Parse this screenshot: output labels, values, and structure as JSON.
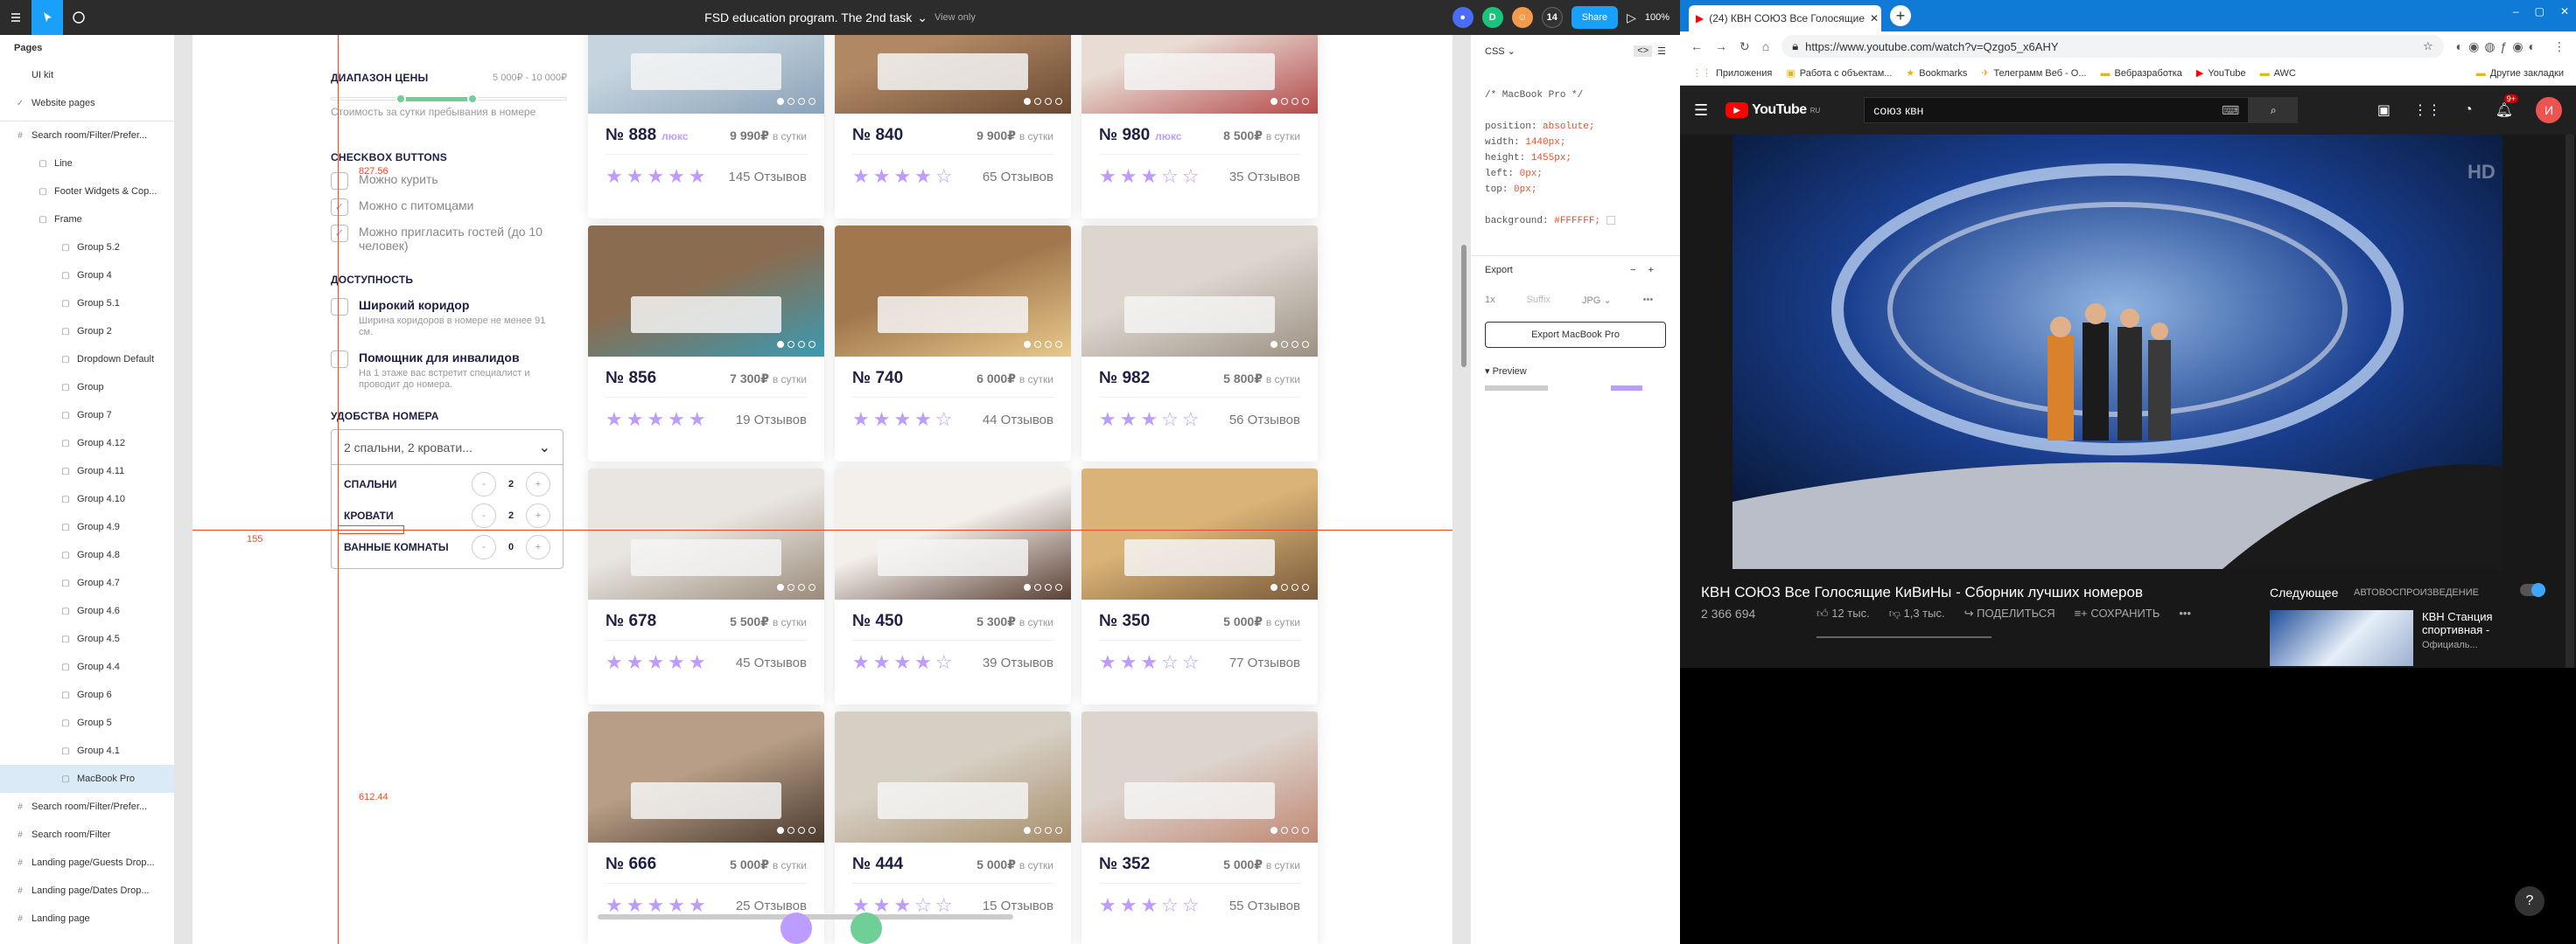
{
  "figma": {
    "title": "FSD education program. The 2nd task",
    "view_mode": "View only",
    "zoom": "100%",
    "share_label": "Share",
    "avatars": [
      "D",
      "14"
    ],
    "pages_header": "Pages",
    "pages": [
      {
        "label": "UI kit",
        "checked": false
      },
      {
        "label": "Website pages",
        "checked": true
      }
    ],
    "layers": [
      {
        "label": "Search room/Filter/Prefer...",
        "indent": 0,
        "sel": false
      },
      {
        "label": "Line",
        "indent": 1,
        "sel": false
      },
      {
        "label": "Footer Widgets & Cop...",
        "indent": 1,
        "sel": false
      },
      {
        "label": "Frame",
        "indent": 1,
        "sel": false
      },
      {
        "label": "Group 5.2",
        "indent": 2,
        "sel": false
      },
      {
        "label": "Group 4",
        "indent": 2,
        "sel": false
      },
      {
        "label": "Group 5.1",
        "indent": 2,
        "sel": false
      },
      {
        "label": "Group 2",
        "indent": 2,
        "sel": false
      },
      {
        "label": "Dropdown Default",
        "indent": 2,
        "sel": false
      },
      {
        "label": "Group",
        "indent": 2,
        "sel": false
      },
      {
        "label": "Group 7",
        "indent": 2,
        "sel": false
      },
      {
        "label": "Group 4.12",
        "indent": 2,
        "sel": false
      },
      {
        "label": "Group 4.11",
        "indent": 2,
        "sel": false
      },
      {
        "label": "Group 4.10",
        "indent": 2,
        "sel": false
      },
      {
        "label": "Group 4.9",
        "indent": 2,
        "sel": false
      },
      {
        "label": "Group 4.8",
        "indent": 2,
        "sel": false
      },
      {
        "label": "Group 4.7",
        "indent": 2,
        "sel": false
      },
      {
        "label": "Group 4.6",
        "indent": 2,
        "sel": false
      },
      {
        "label": "Group 4.5",
        "indent": 2,
        "sel": false
      },
      {
        "label": "Group 4.4",
        "indent": 2,
        "sel": false
      },
      {
        "label": "Group 6",
        "indent": 2,
        "sel": false
      },
      {
        "label": "Group 5",
        "indent": 2,
        "sel": false
      },
      {
        "label": "Group 4.1",
        "indent": 2,
        "sel": false
      },
      {
        "label": "MacBook Pro",
        "indent": 2,
        "sel": true
      },
      {
        "label": "Search room/Filter/Prefer...",
        "indent": 0,
        "sel": false
      },
      {
        "label": "Search room/Filter",
        "indent": 0,
        "sel": false
      },
      {
        "label": "Landing page/Guests Drop...",
        "indent": 0,
        "sel": false
      },
      {
        "label": "Landing page/Dates Drop...",
        "indent": 0,
        "sel": false
      },
      {
        "label": "Landing page",
        "indent": 0,
        "sel": false
      }
    ],
    "measure_top": "827.56",
    "measure_left": "155",
    "measure_bottom": "612.44",
    "inspect": {
      "tab": "CSS",
      "comment": "/* MacBook Pro */",
      "props": [
        {
          "k": "position",
          "v": "absolute;"
        },
        {
          "k": "width",
          "v": "1440px;"
        },
        {
          "k": "height",
          "v": "1455px;"
        },
        {
          "k": "left",
          "v": "0px;"
        },
        {
          "k": "top",
          "v": "0px;"
        }
      ],
      "bg_key": "background",
      "bg_val": "#FFFFFF;",
      "export_title": "Export",
      "export_scale": "1x",
      "export_suffix": "Suffix",
      "export_format": "JPG",
      "export_button": "Export MacBook Pro",
      "preview": "Preview"
    }
  },
  "filters": {
    "price_title": "ДИАПАЗОН ЦЕНЫ",
    "price_range": "5 000₽ - 10 000₽",
    "price_hint": "Стоимость за сутки пребывания в номере",
    "checkbox_title": "CHECKBOX BUTTONS",
    "checkboxes": [
      {
        "label": "Можно курить",
        "checked": false
      },
      {
        "label": "Можно с питомцами",
        "checked": true
      },
      {
        "label": "Можно пригласить гостей (до 10 человек)",
        "checked": true
      }
    ],
    "access_title": "ДОСТУПНОСТЬ",
    "access": [
      {
        "label": "Широкий коридор",
        "sub": "Ширина коридоров в номере не менее 91 см."
      },
      {
        "label": "Помощник для инвалидов",
        "sub": "На 1 этаже вас встретит специалист и проводит до номера."
      }
    ],
    "amenities_title": "УДОБСТВА НОМЕРА",
    "amenities_value": "2 спальни, 2 кровати...",
    "counters": [
      {
        "label": "СПАЛЬНИ",
        "value": "2"
      },
      {
        "label": "КРОВАТИ",
        "value": "2"
      },
      {
        "label": "ВАННЫЕ КОМНАТЫ",
        "value": "0"
      }
    ]
  },
  "rooms": [
    {
      "num": "№ 888",
      "lux": "люкс",
      "price": "9 990₽",
      "per": "в сутки",
      "rating": 5,
      "reviews": "145 Отзывов",
      "colors": [
        "#c5d4de",
        "#8aa3b8"
      ]
    },
    {
      "num": "№ 840",
      "lux": "",
      "price": "9 900₽",
      "per": "в сутки",
      "rating": 4,
      "reviews": "65 Отзывов",
      "colors": [
        "#b08864",
        "#6b4a32"
      ]
    },
    {
      "num": "№ 980",
      "lux": "люкс",
      "price": "8 500₽",
      "per": "в сутки",
      "rating": 3,
      "reviews": "35 Отзывов",
      "colors": [
        "#e8dcd4",
        "#b54b4b"
      ]
    },
    {
      "num": "№ 856",
      "lux": "",
      "price": "7 300₽",
      "per": "в сутки",
      "rating": 5,
      "reviews": "19 Отзывов",
      "colors": [
        "#8a6c50",
        "#3a9ab3"
      ]
    },
    {
      "num": "№ 740",
      "lux": "",
      "price": "6 000₽",
      "per": "в сутки",
      "rating": 4,
      "reviews": "44 Отзывов",
      "colors": [
        "#a1784e",
        "#e8c98a"
      ]
    },
    {
      "num": "№ 982",
      "lux": "",
      "price": "5 800₽",
      "per": "в сутки",
      "rating": 3,
      "reviews": "56 Отзывов",
      "colors": [
        "#dcd6cf",
        "#9d9184"
      ]
    },
    {
      "num": "№ 678",
      "lux": "",
      "price": "5 500₽",
      "per": "в сутки",
      "rating": 5,
      "reviews": "45 Отзывов",
      "colors": [
        "#e9e6e1",
        "#9b8b7b"
      ]
    },
    {
      "num": "№ 450",
      "lux": "",
      "price": "5 300₽",
      "per": "в сутки",
      "rating": 4,
      "reviews": "39 Отзывов",
      "colors": [
        "#f3efea",
        "#5a4034"
      ]
    },
    {
      "num": "№ 350",
      "lux": "",
      "price": "5 000₽",
      "per": "в сутки",
      "rating": 3,
      "reviews": "77 Отзывов",
      "colors": [
        "#d9b377",
        "#7a5a3a"
      ]
    },
    {
      "num": "№ 666",
      "lux": "",
      "price": "5 000₽",
      "per": "в сутки",
      "rating": 5,
      "reviews": "25 Отзывов",
      "colors": [
        "#b89e86",
        "#4a3a2e"
      ]
    },
    {
      "num": "№ 444",
      "lux": "",
      "price": "5 000₽",
      "per": "в сутки",
      "rating": 3,
      "reviews": "15 Отзывов",
      "colors": [
        "#d6cfc4",
        "#a88f6c"
      ]
    },
    {
      "num": "№ 352",
      "lux": "",
      "price": "5 000₽",
      "per": "в сутки",
      "rating": 3,
      "reviews": "55 Отзывов",
      "colors": [
        "#ddd4ce",
        "#c08873"
      ]
    }
  ],
  "browser": {
    "tab_title": "(24) КВН СОЮЗ Все Голосящие",
    "url": "https://www.youtube.com/watch?v=Qzgo5_x6AHY",
    "bookmarks": [
      "Приложения",
      "Работа с объектам...",
      "Bookmarks",
      "Телеграмм Веб - О...",
      "Вебразработка",
      "YouTube",
      "AWC",
      "Другие закладки"
    ]
  },
  "youtube": {
    "logo": "YouTube",
    "region": "RU",
    "search": "союз квн",
    "notif_count": "9+",
    "avatar": "И",
    "video_title": "КВН СОЮЗ Все Голосящие КиВиНы - Сборник лучших номеров",
    "views": "2 366 694",
    "likes": "12 тыс.",
    "dislikes": "1,3 тыс.",
    "share": "ПОДЕЛИТЬСЯ",
    "save": "СОХРАНИТЬ",
    "next": "Следующее",
    "autoplay": "АВТОВОСПРОИЗВЕДЕНИЕ",
    "next_title": "КВН Станция спортивная -",
    "next_channel": "Официаль...",
    "help": "?"
  },
  "colors": {
    "accent": "#18a0fb",
    "purple": "#bc9cff",
    "green": "#6fcf97",
    "guide": "#f24822",
    "yt_red": "#ff0000"
  }
}
